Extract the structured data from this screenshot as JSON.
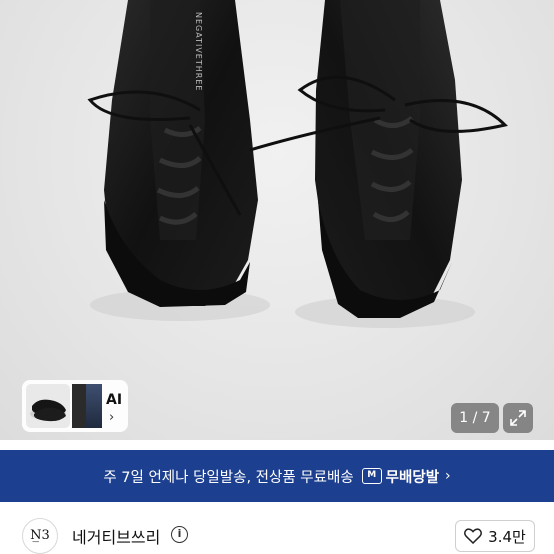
{
  "product_image": {
    "brand_print": "NEGATIVETHREE",
    "thumbnail_badge": "AI",
    "counter": "1 / 7"
  },
  "banner": {
    "text": "주 7일 언제나 당일발송, 전상품 무료배송",
    "badge_text": "무배당발",
    "badge_icon_text": "M"
  },
  "seller": {
    "logo_text": "N̲3",
    "name": "네거티브쓰리",
    "info_symbol": "i",
    "like_count": "3.4만"
  },
  "icons": {
    "expand": "expand-icon",
    "heart": "heart-icon",
    "info": "info-icon",
    "chevron": "chevron-right-icon"
  },
  "colors": {
    "banner_bg": "#1c3f8f",
    "shoe": "#141414"
  }
}
